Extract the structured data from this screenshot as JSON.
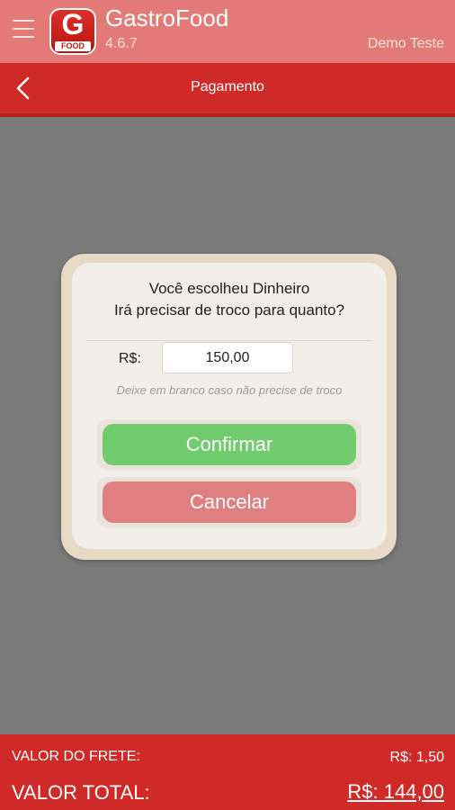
{
  "header": {
    "app_title": "GastroFood",
    "version": "4.6.7",
    "user": "Demo Teste",
    "logo_letter": "G",
    "logo_text": "FOOD"
  },
  "nav": {
    "title": "Pagamento"
  },
  "dialog": {
    "message_line1": "Você escolheu Dinheiro",
    "message_line2": "Irá precisar de troco para quanto?",
    "currency_label": "R$:",
    "amount_value": "150,00",
    "hint": "Deixe em branco caso não precise de troco",
    "confirm_label": "Confirmar",
    "cancel_label": "Cancelar"
  },
  "footer": {
    "freight_label": "VALOR DO FRETE:",
    "freight_value": "R$: 1,50",
    "total_label": "VALOR TOTAL:",
    "total_value": "R$: 144,00"
  },
  "colors": {
    "header_bg": "#e47a77",
    "nav_bg": "#d02a28",
    "confirm": "#6fcb6c",
    "cancel": "#e07f80"
  }
}
